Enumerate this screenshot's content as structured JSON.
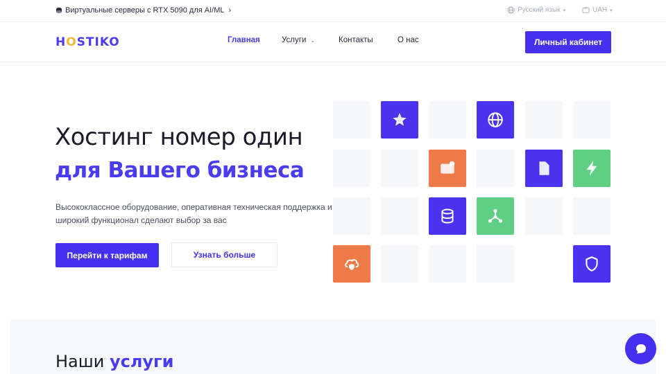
{
  "topbar": {
    "promo_text": "Виртуальные серверы с RTX 5090 для AI/ML",
    "promo_chevron": "›",
    "language": "Русский язык",
    "currency": "UAH"
  },
  "header": {
    "logo": {
      "part1": "H",
      "part2": "O",
      "part3": "STIKO"
    },
    "nav": [
      {
        "label": "Главная",
        "active": true
      },
      {
        "label": "Услуги",
        "has_dropdown": true
      },
      {
        "label": "Контакты"
      },
      {
        "label": "О нас"
      }
    ],
    "cabinet_label": "Личный кабинет"
  },
  "hero": {
    "title_line1": "Хостинг номер один",
    "title_line2": "для Вашего бизнеса",
    "subtitle": "Высококлассное оборудование, оперативная техническая поддержка и широкий функционал сделают выбор за вас",
    "primary_button": "Перейти к тарифам",
    "secondary_button": "Узнать больше"
  },
  "icon_grid": {
    "icons": [
      "star-icon",
      "globe-icon",
      "mail-icon",
      "file-icon",
      "lightning-icon",
      "database-icon",
      "network-icon",
      "cloud-shield-icon",
      "shield-icon"
    ]
  },
  "services": {
    "title_plain": "Наши",
    "title_highlight": "услуги"
  },
  "colors": {
    "brand": "#4530ef",
    "orange": "#ee7a47",
    "green": "#5fcf84",
    "tile": "#f6f7fb"
  }
}
